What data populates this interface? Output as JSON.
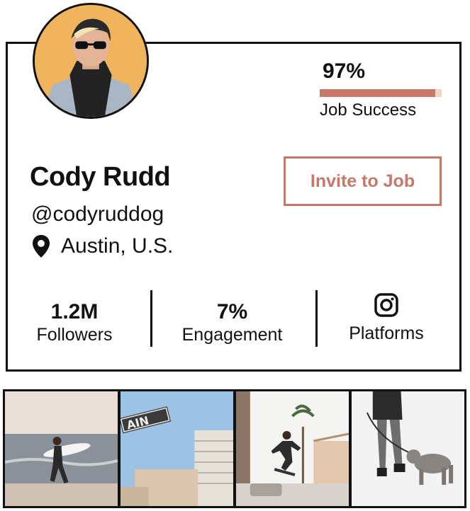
{
  "profile": {
    "name": "Cody Rudd",
    "handle": "@codyruddog",
    "location": "Austin, U.S.",
    "avatar_icon": "profile-photo"
  },
  "job_success": {
    "value_text": "97%",
    "value": 0.95,
    "label": "Job Success"
  },
  "actions": {
    "invite_label": "Invite to Job"
  },
  "stats": {
    "followers_value": "1.2M",
    "followers_label": "Followers",
    "engagement_value": "7%",
    "engagement_label": "Engagement",
    "platforms_label": "Platforms",
    "platform_icon": "instagram-icon"
  },
  "colors": {
    "accent": "#c8786a",
    "accent_light": "#f1d6c3",
    "border": "#111111",
    "avatar_bg": "#f0b45c"
  },
  "gallery": [
    {
      "icon": "surfer-photo"
    },
    {
      "icon": "street-sign-photo"
    },
    {
      "icon": "skateboarder-photo"
    },
    {
      "icon": "dog-walk-photo"
    }
  ]
}
